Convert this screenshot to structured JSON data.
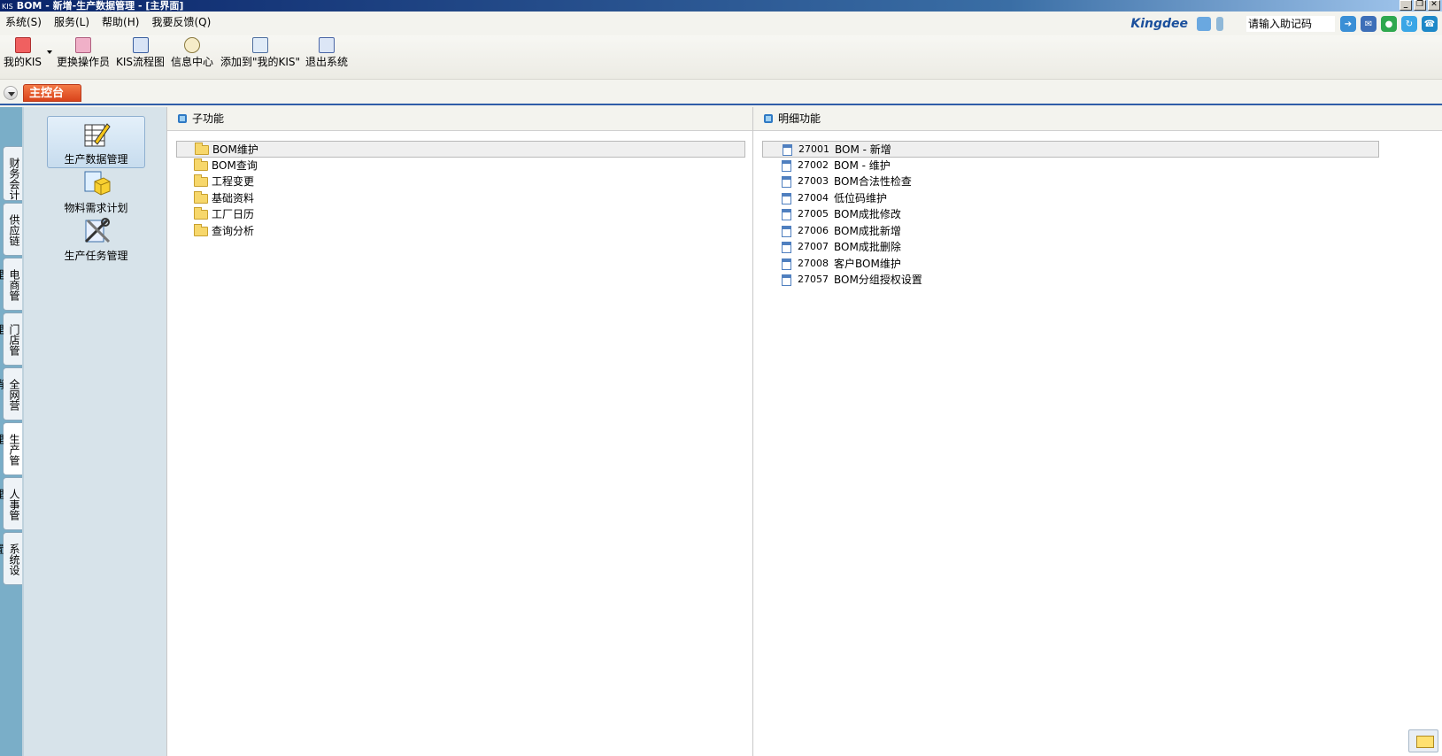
{
  "window": {
    "kis_mark": "KIS",
    "title": "BOM - 新增-生产数据管理 - [主界面]",
    "buttons": [
      "_",
      "❐",
      "✕"
    ]
  },
  "menu": [
    {
      "label": "系统(S)"
    },
    {
      "label": "服务(L)"
    },
    {
      "label": "帮助(H)"
    },
    {
      "label": "我要反馈(Q)"
    }
  ],
  "top_right": {
    "logo": "Kingdee",
    "assist_placeholder": "请输入助记码"
  },
  "toolbar": [
    {
      "label": "我的KIS",
      "icon": "star-icon"
    },
    {
      "label": "更换操作员",
      "icon": "users-icon"
    },
    {
      "label": "KIS流程图",
      "icon": "flowchart-icon"
    },
    {
      "label": "信息中心",
      "icon": "message-icon"
    },
    {
      "label": "添加到\"我的KIS\"",
      "icon": "add-favorite-icon"
    },
    {
      "label": "退出系统",
      "icon": "exit-icon"
    }
  ],
  "main_tab": "主控台",
  "side_tabs": [
    "财务会计",
    "供应链",
    "电商管理",
    "门店管理",
    "全网营销",
    "生产管理",
    "人事管理",
    "系统设置"
  ],
  "active_side_tab": "生产管理",
  "modules": [
    {
      "label": "生产数据管理",
      "active": true
    },
    {
      "label": "物料需求计划",
      "active": false
    },
    {
      "label": "生产任务管理",
      "active": false
    }
  ],
  "subfunctions": {
    "header": "子功能",
    "items": [
      "BOM维护",
      "BOM查询",
      "工程变更",
      "基础资料",
      "工厂日历",
      "查询分析"
    ]
  },
  "details": {
    "header": "明细功能",
    "items": [
      {
        "code": "27001",
        "name": "BOM - 新增"
      },
      {
        "code": "27002",
        "name": "BOM - 维护"
      },
      {
        "code": "27003",
        "name": "BOM合法性检查"
      },
      {
        "code": "27004",
        "name": "低位码维护"
      },
      {
        "code": "27005",
        "name": "BOM成批修改"
      },
      {
        "code": "27006",
        "name": "BOM成批新增"
      },
      {
        "code": "27007",
        "name": "BOM成批删除"
      },
      {
        "code": "27008",
        "name": "客户BOM维护"
      },
      {
        "code": "27057",
        "name": "BOM分组授权设置"
      }
    ]
  }
}
